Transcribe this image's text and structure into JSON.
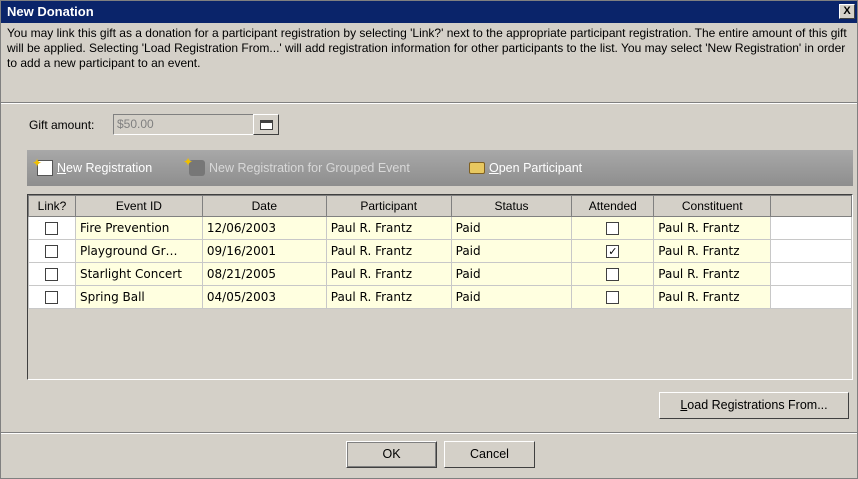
{
  "window": {
    "title": "New Donation",
    "close_glyph": "X"
  },
  "intro_text": "You may link this gift as a donation for a participant registration by selecting 'Link?' next to the appropriate participant registration. The entire amount of this gift will be applied.  Selecting 'Load Registration From...' will add registration information for other participants to the list.  You may select 'New Registration' in order to add a new participant to an event.",
  "gift": {
    "label": "Gift amount:",
    "value": "$50.00"
  },
  "toolbar": {
    "new_registration_mnemonic": "N",
    "new_registration_rest": "ew Registration",
    "grouped_event": "New Registration for Grouped Event",
    "open_participant_mnemonic": "O",
    "open_participant_rest": "pen Participant"
  },
  "grid": {
    "columns": [
      "Link?",
      "Event ID",
      "Date",
      "Participant",
      "Status",
      "Attended",
      "Constituent"
    ],
    "rows": [
      {
        "link": false,
        "event_id": "Fire Prevention",
        "date": "12/06/2003",
        "participant": "Paul R. Frantz",
        "status": "Paid",
        "attended": false,
        "constituent": "Paul R. Frantz"
      },
      {
        "link": false,
        "event_id": "Playground Gr…",
        "date": "09/16/2001",
        "participant": "Paul R. Frantz",
        "status": "Paid",
        "attended": true,
        "constituent": "Paul R. Frantz"
      },
      {
        "link": false,
        "event_id": "Starlight Concert",
        "date": "08/21/2005",
        "participant": "Paul R. Frantz",
        "status": "Paid",
        "attended": false,
        "constituent": "Paul R. Frantz"
      },
      {
        "link": false,
        "event_id": "Spring Ball",
        "date": "04/05/2003",
        "participant": "Paul R. Frantz",
        "status": "Paid",
        "attended": false,
        "constituent": "Paul R. Frantz"
      }
    ]
  },
  "buttons": {
    "load_mnemonic": "L",
    "load_rest": "oad Registrations From...",
    "ok": "OK",
    "cancel": "Cancel"
  },
  "icons": {
    "new_registration": "new-document-icon",
    "grouped_event": "group-icon",
    "open_participant": "open-folder-icon",
    "calendar": "calendar-icon"
  }
}
